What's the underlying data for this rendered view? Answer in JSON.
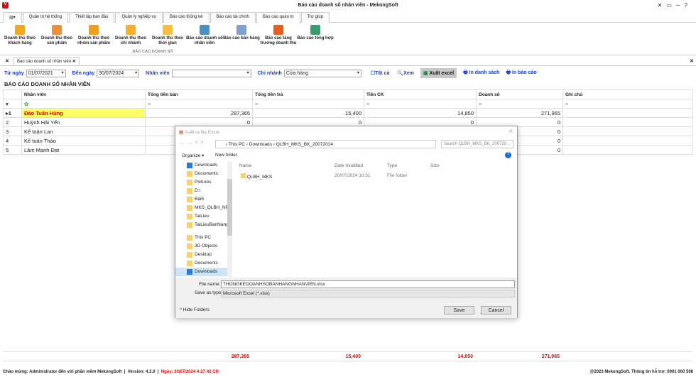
{
  "app": {
    "title": "Báo cáo doanh số nhân viên - MekongSoft"
  },
  "menu_tabs": [
    "Quản trị hệ thống",
    "Thiết lập ban đầu",
    "Quản lý nghiệp vụ",
    "Báo cáo thống kê",
    "Báo cáo tài chính",
    "Báo cáo quản trị",
    "Trợ giúp"
  ],
  "ribbon": {
    "group": "BÁO CÁO DOANH SỐ",
    "buttons": [
      {
        "label": "Doanh thu theo khách hàng",
        "color": "#f0a820"
      },
      {
        "label": "Doanh thu theo sản phẩm",
        "color": "#e89040"
      },
      {
        "label": "Doanh thu theo nhóm sản phẩm",
        "color": "#f0a020"
      },
      {
        "label": "Doanh thu theo chi nhánh",
        "color": "#f5b030"
      },
      {
        "label": "Doanh thu theo thời gian",
        "color": "#f5c040"
      },
      {
        "label": "Báo cáo doanh số nhân viên",
        "color": "#4a90c0"
      },
      {
        "label": "Báo cáo bán hàng",
        "color": "#80a0d0"
      },
      {
        "label": "Báo cáo tăng trưởng doanh thu",
        "color": "#e06020"
      },
      {
        "label": "Báo cáo tổng hợp",
        "color": "#3a9a70"
      }
    ]
  },
  "doc_tab": "Báo cáo doanh số nhân viên",
  "filter": {
    "from_label": "Từ ngày",
    "from": "01/07/2021",
    "to_label": "Đến ngày",
    "to": "30/07/2024",
    "staff_label": "Nhân viên",
    "staff": "",
    "branch_label": "Chi nhánh",
    "branch": "Cửa hàng",
    "all": "Tất cả",
    "view": "Xem",
    "excel": "Xuất excel",
    "print_list": "In danh sách",
    "print_report": "In báo cáo"
  },
  "section_title": "BÁO CÁO DOANH SỐ NHÂN VIÊN",
  "table": {
    "headers": [
      "Nhân viên",
      "Tổng tiền bán",
      "Tổng tiền trả",
      "Tiền CK",
      "Doanh số",
      "Ghi chú"
    ],
    "rows": [
      [
        "1",
        "Đào Tuấn Hùng",
        "287,365",
        "15,400",
        "14,850",
        "271,965",
        ""
      ],
      [
        "2",
        "Huỳnh Hải Yến",
        "0",
        "0",
        "0",
        "0",
        ""
      ],
      [
        "3",
        "Kế toán Lan",
        "",
        "",
        "",
        "0",
        ""
      ],
      [
        "4",
        "Kế toán Thảo",
        "",
        "",
        "",
        "0",
        ""
      ],
      [
        "5",
        "Lâm Mạnh Đạt",
        "",
        "",
        "",
        "0",
        ""
      ]
    ],
    "totals": [
      "287,365",
      "15,400",
      "14,850",
      "271,965"
    ]
  },
  "dialog": {
    "title": "Xuất ra file Excel",
    "path": [
      "This PC",
      "Downloads",
      "QLBH_MKS_BK_20072024"
    ],
    "search": "Search QLBH_MKS_BK_200720...",
    "organize": "Organize",
    "new_folder": "New folder",
    "nav": [
      "Downloads",
      "Documents",
      "Pictures",
      "D:\\",
      "Bài5",
      "MKS_QLBH_NPP",
      "TaiLieu",
      "TaiLieuBanNang",
      "This PC",
      "3D Objects",
      "Desktop",
      "Documents",
      "Downloads"
    ],
    "cols": [
      "Name",
      "Date modified",
      "Type",
      "Size"
    ],
    "files": [
      {
        "name": "QLBH_MKS",
        "date": "20/07/2024 10:51",
        "type": "File folder"
      }
    ],
    "file_name_label": "File name:",
    "file_name": "THONGKEDOANHSOBANHANGNHANVIEN.xlsx",
    "type_label": "Save as type:",
    "type": "Microsoft Excel (*.xlsx)",
    "hide": "Hide Folders",
    "save": "Save",
    "cancel": "Cancel"
  },
  "status": {
    "welcome": "Chào mừng: Administrator đến với phần mềm MekongSoft",
    "version": "Version: 4.2.0",
    "date": "Ngày: 30/07/2024 4:27:42 CH",
    "copyright": "@2023 MekongSoft. Thông tin hỗ trợ: 0901 000 508"
  }
}
